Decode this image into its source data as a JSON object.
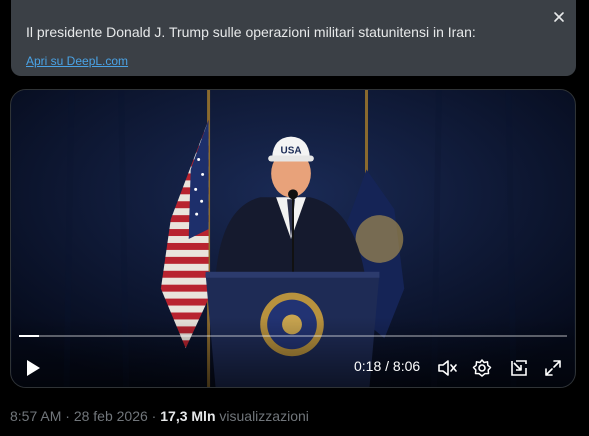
{
  "translation": {
    "text": "Il presidente Donald J. Trump sulle operazioni militari statunitensi in Iran:",
    "link_label": "Apri su DeepL.com",
    "close_icon": "close-icon"
  },
  "video": {
    "cap_text": "USA",
    "time_display": "0:18 / 8:06",
    "progress": 0.037,
    "icons": [
      "play-icon",
      "mute-icon",
      "settings-icon",
      "picture-in-picture-icon",
      "fullscreen-icon"
    ]
  },
  "meta": {
    "time": "8:57 AM",
    "sep1": " · ",
    "date": "28 feb 2026",
    "sep2": " · ",
    "views": "17,3 Mln",
    "views_label": " visualizzazioni"
  },
  "colors": {
    "background": "#000000",
    "banner": "#3b4046",
    "link": "#4aa3e6",
    "muted_text": "#71767b"
  }
}
